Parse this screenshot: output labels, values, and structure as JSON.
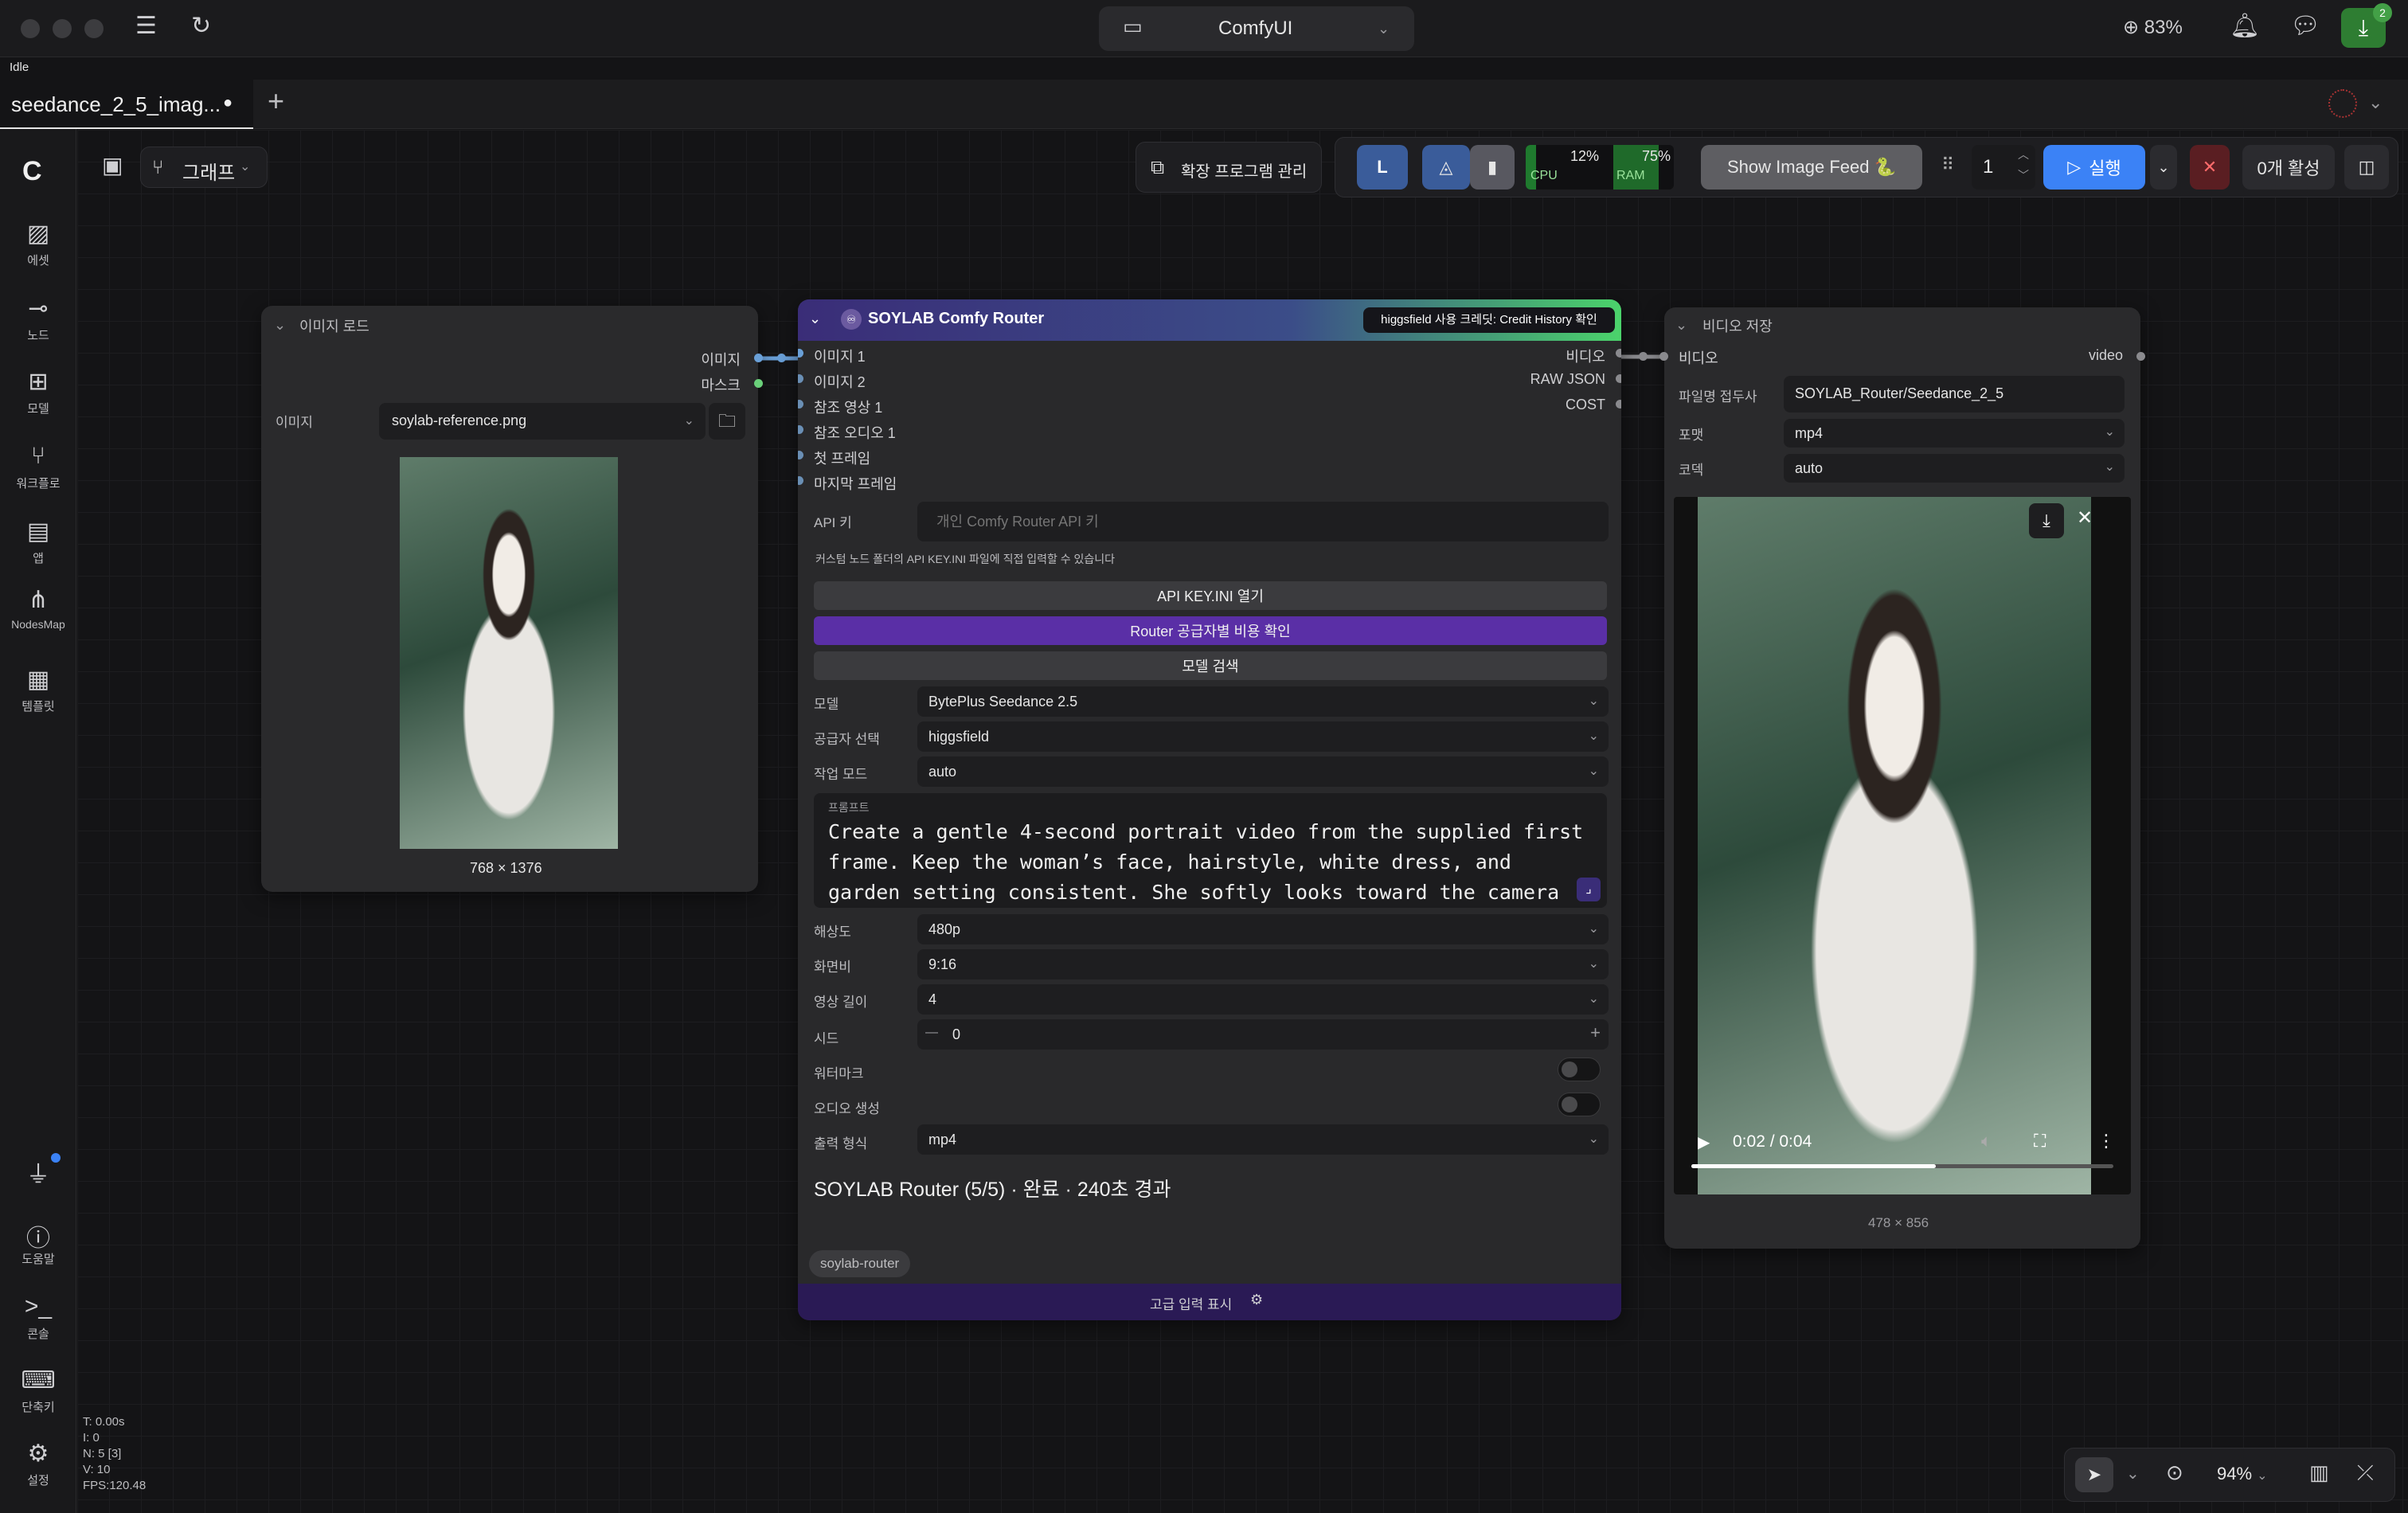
{
  "app": {
    "title": "ComfyUI",
    "zoom": "83%",
    "status": "Idle",
    "notif_count": "2"
  },
  "tab": {
    "label": "seedance_2_5_imag...",
    "modified_dot": "●",
    "add": "+"
  },
  "toolbar": {
    "graph_label": "그래프",
    "ext_manager": "확장 프로그램 관리",
    "cpu_pct": "12%",
    "cpu_label": "CPU",
    "ram_pct": "75%",
    "ram_label": "RAM",
    "show_image_feed": "Show Image Feed 🐍",
    "batch_count": "1",
    "run": "실행",
    "active": "0개 활성"
  },
  "sidebar": {
    "items": [
      "에셋",
      "노드",
      "모델",
      "워크플로",
      "앱",
      "NodesMap",
      "템플릿"
    ],
    "bottom": [
      "도움말",
      "콘솔",
      "단축키",
      "설정"
    ]
  },
  "load_image": {
    "title": "이미지 로드",
    "out_image": "이미지",
    "out_mask": "마스크",
    "image_label": "이미지",
    "image_value": "soylab-reference.png",
    "dims": "768 × 1376"
  },
  "router": {
    "title": "SOYLAB Comfy Router",
    "badge": "higgsfield 사용 크레딧: Credit History 확인",
    "inputs": [
      "이미지 1",
      "이미지 2",
      "참조 영상 1",
      "참조 오디오 1",
      "첫 프레임",
      "마지막 프레임"
    ],
    "outputs": [
      "비디오",
      "RAW JSON",
      "COST"
    ],
    "api_label": "API 키",
    "api_placeholder": "개인 Comfy Router API 키",
    "note": "커스텀 노드 폴더의 API KEY.INI 파일에 직접 입력할 수 있습니다",
    "btn_open": "API KEY.INI 열기",
    "btn_cost": "Router 공급자별 비용 확인",
    "btn_search": "모델 검색",
    "model_label": "모델",
    "model_value": "BytePlus Seedance 2.5",
    "provider_label": "공급자 선택",
    "provider_value": "higgsfield",
    "mode_label": "작업 모드",
    "mode_value": "auto",
    "prompt_label": "프롬프트",
    "prompt_line1": "Create a gentle 4-second portrait video from the supplied first",
    "prompt_line2": "frame. Keep the woman’s face, hairstyle, white dress, and",
    "prompt_line3": "garden setting consistent. She softly looks toward the camera",
    "res_label": "해상도",
    "res_value": "480p",
    "aspect_label": "화면비",
    "aspect_value": "9:16",
    "duration_label": "영상 길이",
    "duration_value": "4",
    "seed_label": "시드",
    "seed_value": "0",
    "watermark_label": "워터마크",
    "audio_label": "오디오 생성",
    "format_label": "출력 형식",
    "format_value": "mp4",
    "status": "SOYLAB Router (5/5) · 완료 · 240초 경과",
    "tag": "soylab-router",
    "advanced": "고급 입력 표시"
  },
  "save_video": {
    "title": "비디오 저장",
    "in_video": "비디오",
    "out_video": "video",
    "prefix_label": "파일명 접두사",
    "prefix_value": "SOYLAB_Router/Seedance_2_5",
    "format_label": "포맷",
    "format_value": "mp4",
    "codec_label": "코덱",
    "codec_value": "auto",
    "time": "0:02 / 0:04",
    "progress": 0.58,
    "dims": "478 × 856"
  },
  "stats": {
    "t": "T: 0.00s",
    "i": "I: 0",
    "n": "N: 5 [3]",
    "v": "V: 10",
    "fps": "FPS:120.48"
  },
  "zoom_ctrl": {
    "value": "94%"
  },
  "colors": {
    "accent": "#3b82f6",
    "router_header_start": "#3a2d78",
    "router_header_end": "#4bd36b",
    "router_btn_purple": "#5a2fa6",
    "router_footer": "#2a1a55"
  }
}
